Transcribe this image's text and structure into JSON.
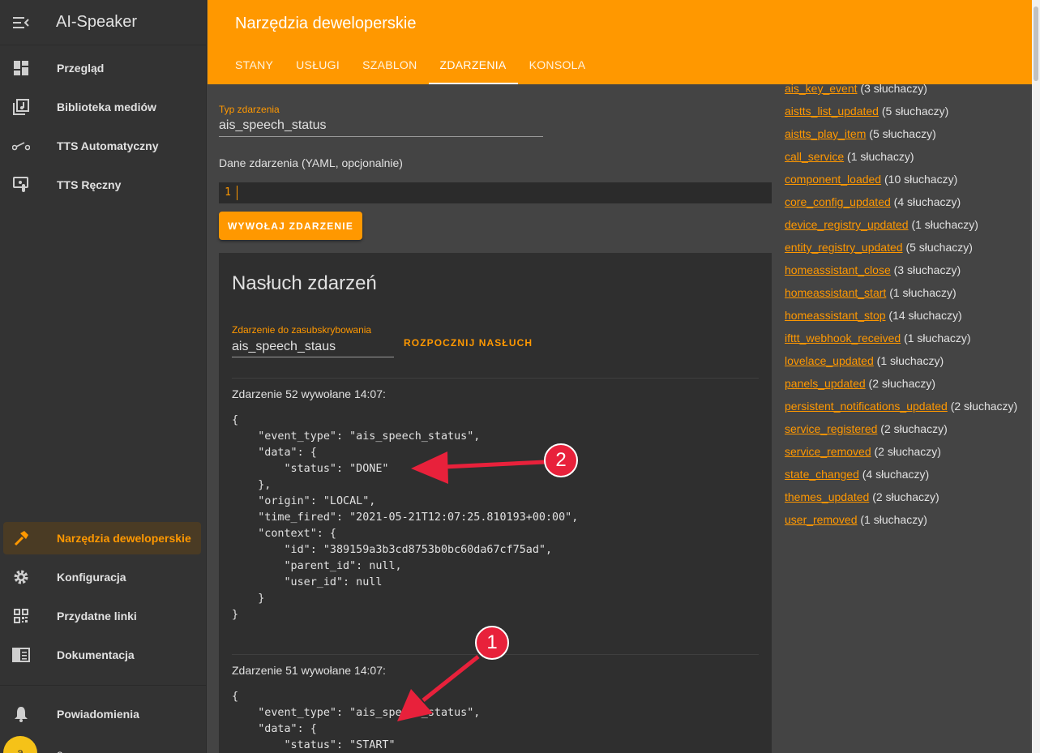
{
  "sidebar": {
    "title": "AI-Speaker",
    "items": [
      {
        "label": "Przegląd",
        "icon": "dashboard-icon"
      },
      {
        "label": "Biblioteka mediów",
        "icon": "media-library-icon"
      },
      {
        "label": "TTS Automatyczny",
        "icon": "switch-icon"
      },
      {
        "label": "TTS Ręczny",
        "icon": "touch-monitor-icon"
      }
    ],
    "bottom_items": [
      {
        "label": "Narzędzia deweloperskie",
        "icon": "hammer-icon",
        "active": true
      },
      {
        "label": "Konfiguracja",
        "icon": "gear-icon"
      },
      {
        "label": "Przydatne linki",
        "icon": "qr-code-icon"
      },
      {
        "label": "Dokumentacja",
        "icon": "book-icon"
      }
    ],
    "notifications_label": "Powiadomienia",
    "avatar_letter": "a",
    "user_name": "a"
  },
  "header": {
    "title": "Narzędzia deweloperskie",
    "tabs": [
      {
        "label": "STANY"
      },
      {
        "label": "USŁUGI"
      },
      {
        "label": "SZABLON"
      },
      {
        "label": "ZDARZENIA",
        "active": true
      },
      {
        "label": "KONSOLA"
      }
    ]
  },
  "fire_event": {
    "type_label": "Typ zdarzenia",
    "type_value": "ais_speech_status",
    "yaml_label": "Dane zdarzenia (YAML, opcjonalnie)",
    "editor_line": "1",
    "button_label": "WYWOŁAJ ZDARZENIE"
  },
  "listen": {
    "title": "Nasłuch zdarzeń",
    "subscribe_label": "Zdarzenie do zasubskrybowania",
    "subscribe_value": "ais_speech_staus",
    "button_label": "ROZPOCZNIJ NASŁUCH",
    "events": [
      {
        "header": "Zdarzenie 52 wywołane 14:07:",
        "body": "{\n    \"event_type\": \"ais_speech_status\",\n    \"data\": {\n        \"status\": \"DONE\"\n    },\n    \"origin\": \"LOCAL\",\n    \"time_fired\": \"2021-05-21T12:07:25.810193+00:00\",\n    \"context\": {\n        \"id\": \"389159a3b3cd8753b0bc60da67cf75ad\",\n        \"parent_id\": null,\n        \"user_id\": null\n    }\n}"
      },
      {
        "header": "Zdarzenie 51 wywołane 14:07:",
        "body": "{\n    \"event_type\": \"ais_speech_status\",\n    \"data\": {\n        \"status\": \"START\""
      }
    ]
  },
  "listeners": [
    {
      "event": "ais_key_event",
      "count": "(3 słuchaczy)"
    },
    {
      "event": "aistts_list_updated",
      "count": "(5 słuchaczy)"
    },
    {
      "event": "aistts_play_item",
      "count": "(5 słuchaczy)"
    },
    {
      "event": "call_service",
      "count": "(1 słuchaczy)"
    },
    {
      "event": "component_loaded",
      "count": "(10 słuchaczy)"
    },
    {
      "event": "core_config_updated",
      "count": "(4 słuchaczy)"
    },
    {
      "event": "device_registry_updated",
      "count": "(1 słuchaczy)"
    },
    {
      "event": "entity_registry_updated",
      "count": "(5 słuchaczy)"
    },
    {
      "event": "homeassistant_close",
      "count": "(3 słuchaczy)"
    },
    {
      "event": "homeassistant_start",
      "count": "(1 słuchaczy)"
    },
    {
      "event": "homeassistant_stop",
      "count": "(14 słuchaczy)"
    },
    {
      "event": "ifttt_webhook_received",
      "count": "(1 słuchaczy)"
    },
    {
      "event": "lovelace_updated",
      "count": "(1 słuchaczy)"
    },
    {
      "event": "panels_updated",
      "count": "(2 słuchaczy)"
    },
    {
      "event": "persistent_notifications_updated",
      "count": "(2 słuchaczy)"
    },
    {
      "event": "service_registered",
      "count": "(2 słuchaczy)"
    },
    {
      "event": "service_removed",
      "count": "(2 słuchaczy)"
    },
    {
      "event": "state_changed",
      "count": "(4 słuchaczy)"
    },
    {
      "event": "themes_updated",
      "count": "(2 słuchaczy)"
    },
    {
      "event": "user_removed",
      "count": "(1 słuchaczy)"
    }
  ],
  "annotations": {
    "badge_1": "1",
    "badge_2": "2",
    "color": "#e8213b"
  },
  "colors": {
    "accent": "#ff9800",
    "sidebar_bg": "#333333",
    "main_bg": "#444444",
    "card_bg": "#2f2f2f"
  }
}
